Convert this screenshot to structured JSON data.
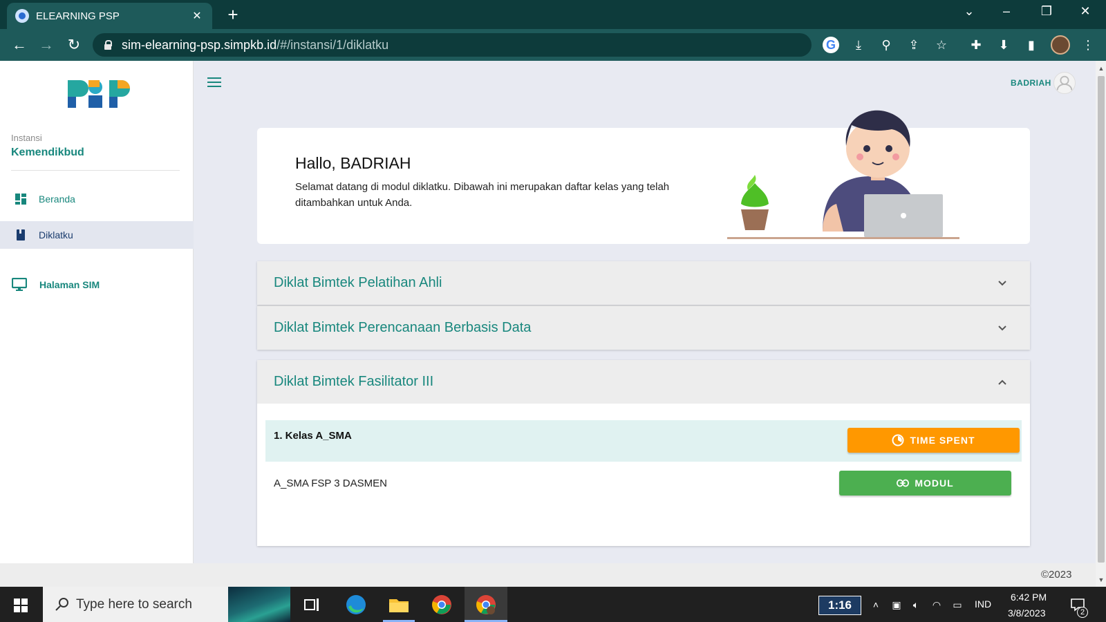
{
  "browser": {
    "tab_title": "ELEARNING PSP",
    "tab_close": "✕",
    "new_tab": "+",
    "url_host": "sim-elearning-psp.simpkb.id",
    "url_path": "/#/instansi/1/diklatku",
    "window_controls": [
      "⌄",
      "–",
      "❐",
      "✕"
    ]
  },
  "sidebar": {
    "instansi_label": "Instansi",
    "instansi_value": "Kemendikbud",
    "items": [
      {
        "label": "Beranda",
        "icon": "dashboard-icon",
        "active": false
      },
      {
        "label": "Diklatku",
        "icon": "book-icon",
        "active": true
      },
      {
        "label": "Halaman SIM",
        "icon": "monitor-icon",
        "active": false
      }
    ],
    "colors": {
      "accent": "#18877d",
      "active_bg": "#e3e6ef"
    }
  },
  "header": {
    "user_name": "BADRIAH"
  },
  "welcome": {
    "title": "Hallo, BADRIAH",
    "text": "Selamat datang di modul diklatku. Dibawah ini merupakan daftar kelas yang telah ditambahkan untuk Anda."
  },
  "accordions": [
    {
      "title": "Diklat Bimtek Pelatihan Ahli",
      "expanded": false
    },
    {
      "title": "Diklat Bimtek Perencanaan Berbasis Data",
      "expanded": false
    },
    {
      "title": "Diklat Bimtek Fasilitator III",
      "expanded": true,
      "class_title": "1. Kelas A_SMA",
      "class_sub": "A_SMA FSP 3 DASMEN",
      "btn_time": "TIME SPENT",
      "btn_modul": "MODUL"
    }
  ],
  "footer": {
    "copyright": "©2023"
  },
  "taskbar": {
    "search_placeholder": "Type here to search",
    "badge": "1:16",
    "lang": "IND",
    "time": "6:42 PM",
    "date": "3/8/2023",
    "notif_count": "2",
    "colors": {
      "button_orange": "#ff9800",
      "button_green": "#4caf50"
    }
  }
}
